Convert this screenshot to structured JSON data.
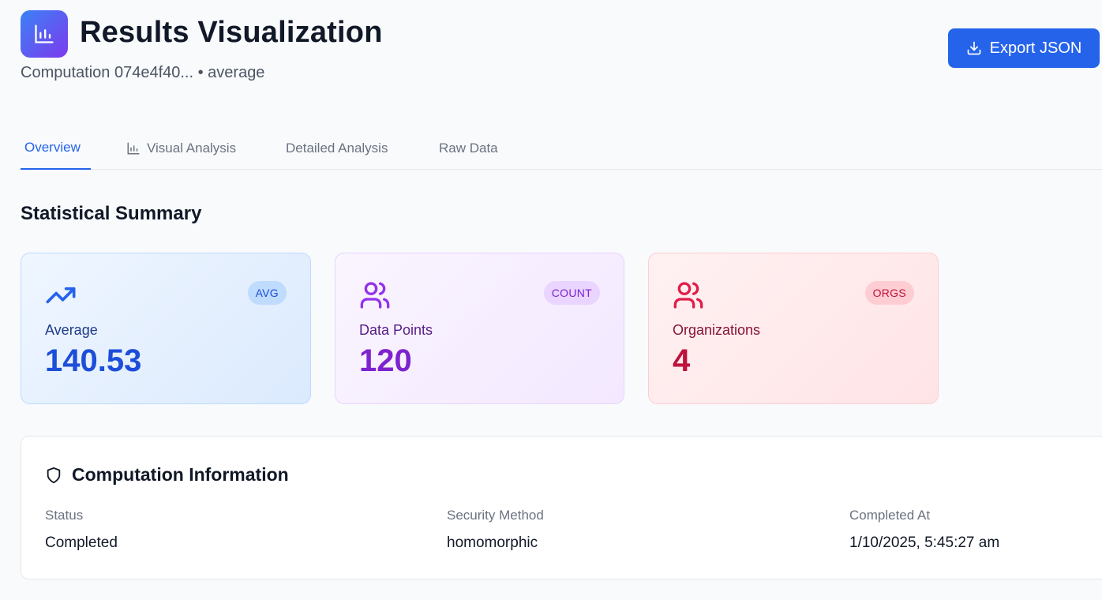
{
  "header": {
    "title": "Results Visualization",
    "subtitle": "Computation 074e4f40... • average",
    "logo_icon": "bar-chart-icon",
    "export_label": "Export JSON",
    "export_icon": "download-icon"
  },
  "tabs": [
    {
      "label": "Overview",
      "active": true
    },
    {
      "label": "Visual Analysis",
      "icon": "bar-chart-icon"
    },
    {
      "label": "Detailed Analysis"
    },
    {
      "label": "Raw Data"
    }
  ],
  "summary": {
    "title": "Statistical Summary",
    "cards": [
      {
        "badge": "AVG",
        "label": "Average",
        "value": "140.53",
        "icon": "trending-up-icon",
        "color": "#1d4ed8"
      },
      {
        "badge": "COUNT",
        "label": "Data Points",
        "value": "120",
        "icon": "users-icon",
        "color": "#7e22ce"
      },
      {
        "badge": "ORGS",
        "label": "Organizations",
        "value": "4",
        "icon": "users-icon",
        "color": "#be123c"
      }
    ]
  },
  "info": {
    "title": "Computation Information",
    "icon": "shield-icon",
    "fields": [
      {
        "label": "Status",
        "value": "Completed"
      },
      {
        "label": "Security Method",
        "value": "homomorphic"
      },
      {
        "label": "Completed At",
        "value": "1/10/2025, 5:45:27 am"
      }
    ]
  },
  "colors": {
    "accent": "#2563eb",
    "brand_gradient_start": "#3b82f6",
    "brand_gradient_end": "#7c3aed"
  }
}
